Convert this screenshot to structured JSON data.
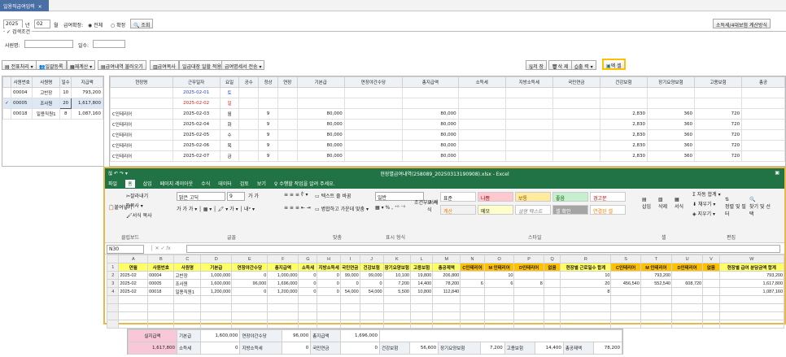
{
  "tab": {
    "title": "일용직급여입력",
    "close": "×"
  },
  "filter": {
    "year": "2025",
    "year_unit": "년",
    "month": "02",
    "month_unit": "월",
    "pay_status_label": "급여확정:",
    "opt_all": "전체",
    "opt_confirmed": "확정",
    "search": "조회",
    "calc_button": "소득세/4대보험 계산방식"
  },
  "search_cond": {
    "legend": "검색조건",
    "employee_label": "사원명:",
    "days_label": "일수:"
  },
  "toolbar": {
    "batch": "전표처리",
    "bulk_register": "일괄등록",
    "recalc": "재계산",
    "fetch_pay": "급여내역 불러오기",
    "pay_slip": "급여복사",
    "daily_apply": "일급대장 일할 적용",
    "pay_send": "급여명세서 전송",
    "save": "저 장",
    "delete": "삭 제",
    "print": "출 력",
    "excel": "엑 셀"
  },
  "left_grid": {
    "headers": [
      "사원번호",
      "사원명",
      "일수",
      "지급액"
    ],
    "rows": [
      {
        "check": "",
        "no": "00004",
        "name": "고반장",
        "days": "10",
        "amount": "793,200"
      },
      {
        "check": "✓",
        "no": "00005",
        "name": "조사원",
        "days": "20",
        "amount": "1,617,800"
      },
      {
        "check": "",
        "no": "00018",
        "name": "일용직원1",
        "days": "8",
        "amount": "1,087,160"
      }
    ]
  },
  "right_grid": {
    "headers": [
      "현장명",
      "근무일자",
      "요일",
      "공수",
      "정상",
      "연장",
      "기본급",
      "연장야간수당",
      "총지급액",
      "소득세",
      "지방소득세",
      "국민연금",
      "건강보험",
      "장기요양보험",
      "고용보험",
      "총공"
    ],
    "rows": [
      [
        "",
        "2025-02-01",
        "토",
        "",
        "",
        "",
        "",
        "",
        "",
        "",
        "",
        "",
        "",
        "",
        "",
        ""
      ],
      [
        "",
        "2025-02-02",
        "일",
        "",
        "",
        "",
        "",
        "",
        "",
        "",
        "",
        "",
        "",
        "",
        "",
        ""
      ],
      [
        "C인테리어",
        "2025-02-03",
        "월",
        "",
        "9",
        "",
        "80,000",
        "",
        "80,000",
        "",
        "",
        "",
        "2,830",
        "360",
        "720",
        ""
      ],
      [
        "C인테리어",
        "2025-02-04",
        "화",
        "",
        "9",
        "",
        "80,000",
        "",
        "80,000",
        "",
        "",
        "",
        "2,830",
        "360",
        "720",
        ""
      ],
      [
        "C인테리어",
        "2025-02-05",
        "수",
        "",
        "9",
        "",
        "80,000",
        "",
        "80,000",
        "",
        "",
        "",
        "2,830",
        "360",
        "720",
        ""
      ],
      [
        "C인테리어",
        "2025-02-06",
        "목",
        "",
        "9",
        "",
        "80,000",
        "",
        "80,000",
        "",
        "",
        "",
        "2,830",
        "360",
        "720",
        ""
      ],
      [
        "C인테리어",
        "2025-02-07",
        "금",
        "",
        "9",
        "",
        "80,000",
        "",
        "80,000",
        "",
        "",
        "",
        "2,830",
        "360",
        "720",
        ""
      ]
    ]
  },
  "excel": {
    "title": "현장별급여내역(258089_20250313190908).xlsx - Excel",
    "menus": [
      "파일",
      "홈",
      "삽입",
      "페이지 레이아웃",
      "수식",
      "데이터",
      "검토",
      "보기",
      "♀ 수행할 작업을 알려 주세요."
    ],
    "font_name": "맑은 고딕",
    "font_size": "9",
    "style_normal": "표준",
    "style_bad": "나쁨",
    "style_neutral": "보통",
    "style_good": "좋음",
    "style_warn": "경고문",
    "style_calc": "계산",
    "style_memo": "메모",
    "style_expl": "설명 텍스트",
    "style_check": "셀 확인",
    "style_linked": "연결된 셀",
    "groups": [
      "클립보드",
      "글꼴",
      "맞춤",
      "표시 형식",
      "스타일",
      "셀",
      "편집"
    ],
    "number_format": "일반",
    "clip": {
      "cut": "잘라내기",
      "copy": "복사",
      "paint": "서식 복사",
      "paste": "붙여넣기"
    },
    "align_items": {
      "wrap": "텍스트 줄 바꿈",
      "merge": "병합하고 가운데 맞춤"
    },
    "table_items": {
      "cond": "조건부 서식",
      "table": "표 서식"
    },
    "cell_items": {
      "insert": "삽입",
      "delete": "삭제",
      "format": "서식"
    },
    "edit_items": {
      "autosum": "자동 합계",
      "fill": "채우기",
      "clear": "지우기",
      "sort": "정렬 및 필터",
      "find": "찾기 및 선택"
    },
    "name_box": "N30",
    "col_letters": [
      "",
      "A",
      "B",
      "C",
      "D",
      "E",
      "F",
      "G",
      "H",
      "I",
      "J",
      "K",
      "L",
      "M",
      "N",
      "O",
      "P",
      "Q",
      "R",
      "S",
      "T",
      "U",
      "V",
      "W"
    ],
    "header_row": [
      "1",
      "연월",
      "사원번호",
      "사원명",
      "기본급",
      "연장야간수당",
      "총지급액",
      "소득세",
      "지방소득세",
      "국민연금",
      "건강보험",
      "장기요양보험",
      "고용보험",
      "총공제액",
      "C인테리어",
      "M 인테리어",
      "D인테리어",
      "없음",
      "현장별 근로일수 합계",
      "C인테리어",
      "M 인테리어",
      "D인테리어",
      "없음",
      "현장별 급여 분담금액 합계"
    ],
    "rows": [
      [
        "2",
        "2025-02",
        "00004",
        "고반장",
        "1,000,000",
        "0",
        "1,000,000",
        "0",
        "0",
        "99,000",
        "99,000",
        "10,100",
        "19,800",
        "206,800",
        "",
        "10",
        "",
        "",
        "10",
        "",
        "793,200",
        "",
        "",
        "793,200"
      ],
      [
        "3",
        "2025-02",
        "00005",
        "조사원",
        "1,600,000",
        "96,000",
        "1,696,000",
        "0",
        "0",
        "0",
        "0",
        "7,200",
        "14,400",
        "78,200",
        "6",
        "6",
        "8",
        "",
        "20",
        "456,540",
        "552,540",
        "608,720",
        "",
        "1,617,800"
      ],
      [
        "4",
        "2025-02",
        "00018",
        "일용직원1",
        "1,200,000",
        "0",
        "1,200,000",
        "0",
        "0",
        "54,000",
        "54,000",
        "5,500",
        "10,800",
        "112,840",
        "",
        "",
        "",
        "",
        "8",
        "",
        "",
        "",
        "",
        "1,087,160"
      ]
    ]
  },
  "summary": {
    "row1": [
      "실지급액",
      "기본급",
      "1,600,000",
      "연장야간수당",
      "96,000",
      "총지급액",
      "1,696,000"
    ],
    "row2": [
      "1,617,800",
      "소득세",
      "0",
      "지방소득세",
      "0",
      "국민연금",
      "0",
      "건강보험",
      "56,600",
      "장기요양보험",
      "7,200",
      "고용보험",
      "14,400",
      "총공제액",
      "78,200"
    ]
  }
}
